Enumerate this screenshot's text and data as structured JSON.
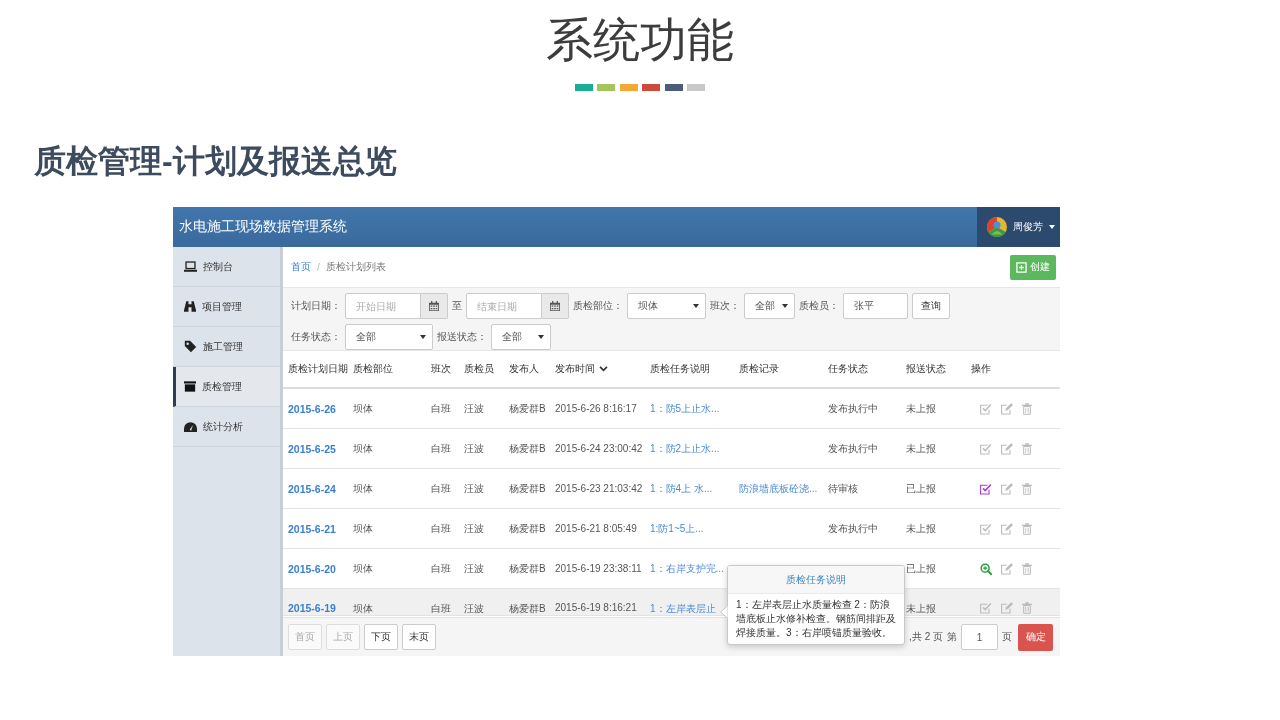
{
  "slide": {
    "title": "系统功能",
    "accent_bars": [
      {
        "color": "#1aae99"
      },
      {
        "color": "#a5c55c"
      },
      {
        "color": "#f5a834"
      },
      {
        "color": "#cf4a3c"
      },
      {
        "color": "#4a5e7a"
      },
      {
        "color": "#c8c8c8"
      }
    ],
    "subtitle": "质检管理-计划及报送总览"
  },
  "app": {
    "header": {
      "title": "水电施工现场数据管理系统",
      "user": "周俊芳"
    },
    "sidebar": {
      "items": [
        {
          "label": "控制台",
          "selected": false
        },
        {
          "label": "项目管理",
          "selected": false
        },
        {
          "label": "施工管理",
          "selected": false
        },
        {
          "label": "质检管理",
          "selected": true
        },
        {
          "label": "统计分析",
          "selected": false
        }
      ]
    },
    "breadcrumb": {
      "items": [
        {
          "label": "首页",
          "kind": "link"
        },
        {
          "label": "质检计划列表",
          "kind": "current"
        }
      ],
      "separator": "/"
    },
    "create_button": {
      "label": "创建"
    },
    "filters": {
      "lines": [
        {
          "fields": [
            {
              "kind": "date-range",
              "label": "计划日期：",
              "start_placeholder": "开始日期",
              "joiner": "至",
              "end_placeholder": "结束日期"
            },
            {
              "kind": "select",
              "label": "质检部位：",
              "value": "坝体"
            },
            {
              "kind": "select",
              "label": "班次：",
              "value": "全部"
            },
            {
              "kind": "text",
              "label": "质检员：",
              "value": "张平"
            },
            {
              "kind": "button",
              "label": "查询"
            }
          ]
        },
        {
          "fields": [
            {
              "kind": "select",
              "label": "任务状态：",
              "value": "全部"
            },
            {
              "kind": "select",
              "label": "报送状态：",
              "value": "全部"
            }
          ]
        }
      ]
    },
    "table": {
      "columns": [
        {
          "label": "质检计划日期",
          "sorted": false
        },
        {
          "label": "质检部位",
          "sorted": false
        },
        {
          "label": "班次",
          "sorted": false
        },
        {
          "label": "质检员",
          "sorted": false
        },
        {
          "label": "发布人",
          "sorted": false
        },
        {
          "label": "发布时间",
          "sorted": true
        },
        {
          "label": "质检任务说明",
          "sorted": false
        },
        {
          "label": "质检记录",
          "sorted": false
        },
        {
          "label": "任务状态",
          "sorted": false
        },
        {
          "label": "报送状态",
          "sorted": false
        },
        {
          "label": "操作",
          "sorted": false
        }
      ],
      "rows": [
        {
          "date": "2015-6-26",
          "part": "坝体",
          "shift": "白班",
          "inspector": "汪波",
          "publisher": "杨爱群B",
          "published_at": "2015-6-26 8:16:17",
          "task": "1：防5上止水...",
          "task_status": "发布执行中",
          "report_status": "未上报",
          "highlighted": false,
          "action": {
            "kind": "check",
            "active": false
          }
        },
        {
          "date": "2015-6-25",
          "part": "坝体",
          "shift": "白班",
          "inspector": "汪波",
          "publisher": "杨爱群B",
          "published_at": "2015-6-24 23:00:42",
          "task": "1：防2上止水...",
          "task_status": "发布执行中",
          "report_status": "未上报",
          "highlighted": false,
          "action": {
            "kind": "check",
            "active": false
          }
        },
        {
          "date": "2015-6-24",
          "part": "坝体",
          "shift": "白班",
          "inspector": "汪波",
          "publisher": "杨爱群B",
          "published_at": "2015-6-23 21:03:42",
          "task": "1：防4上 水...",
          "record": "防浪墙底板砼浇...",
          "task_status": "待审核",
          "report_status": "已上报",
          "highlighted": false,
          "action": {
            "kind": "check",
            "active": true
          }
        },
        {
          "date": "2015-6-21",
          "part": "坝体",
          "shift": "白班",
          "inspector": "汪波",
          "publisher": "杨爱群B",
          "published_at": "2015-6-21 8:05:49",
          "task": "1:防1~5上...",
          "task_status": "发布执行中",
          "report_status": "未上报",
          "highlighted": false,
          "action": {
            "kind": "check",
            "active": false
          }
        },
        {
          "date": "2015-6-20",
          "part": "坝体",
          "shift": "白班",
          "inspector": "汪波",
          "publisher": "杨爱群B",
          "published_at": "2015-6-19 23:38:11",
          "task": "1：右岸支护完...",
          "report_status": "已上报",
          "highlighted": false,
          "action": {
            "kind": "view",
            "active": true
          }
        },
        {
          "date": "2015-6-19",
          "part": "坝体",
          "shift": "白班",
          "inspector": "汪波",
          "publisher": "杨爱群B",
          "published_at": "2015-6-19 8:16:21",
          "task": "1：左岸表层止",
          "report_status": "未上报",
          "highlighted": true,
          "action": {
            "kind": "check",
            "active": false
          }
        }
      ]
    },
    "popover": {
      "title": "质检任务说明",
      "body": "1：左岸表层止水质量检查 2：防浪墙底板止水修补检查。钢筋间排距及焊接质量。3：右岸喷锚质量验收。"
    },
    "pager": {
      "buttons": [
        {
          "label": "首页",
          "disabled": true
        },
        {
          "label": "上页",
          "disabled": true
        },
        {
          "label": "下页",
          "disabled": false
        },
        {
          "label": "末页",
          "disabled": false
        }
      ],
      "total": ",共 2 页",
      "page_label": "第",
      "page": "1",
      "page_unit": "页",
      "confirm": "确定"
    }
  }
}
